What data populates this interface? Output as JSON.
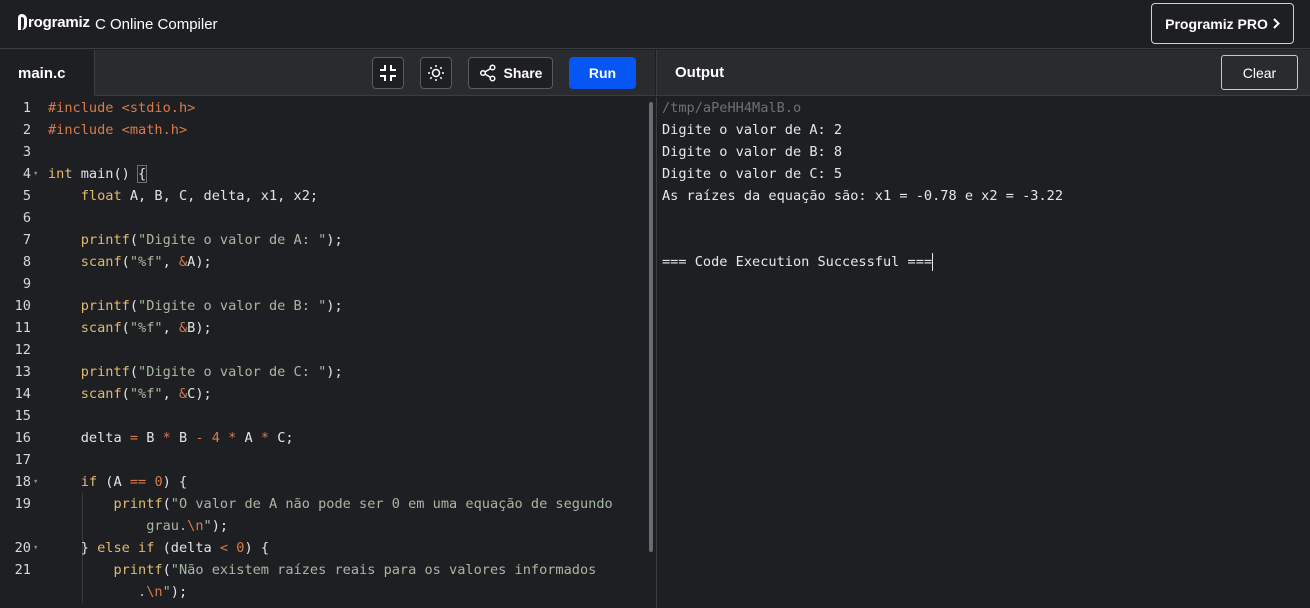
{
  "header": {
    "logo_text": "rogramiz",
    "title": "C Online Compiler",
    "pro_button": "Programiz PRO"
  },
  "editor": {
    "file_tab": "main.c",
    "share_label": "Share",
    "run_label": "Run",
    "lines": [
      {
        "n": "1",
        "fold": false,
        "segs": [
          [
            "inc",
            "#include "
          ],
          [
            "op",
            "<stdio.h>"
          ]
        ]
      },
      {
        "n": "2",
        "fold": false,
        "segs": [
          [
            "inc",
            "#include "
          ],
          [
            "op",
            "<math.h>"
          ]
        ]
      },
      {
        "n": "3",
        "fold": false,
        "segs": []
      },
      {
        "n": "4",
        "fold": true,
        "segs": [
          [
            "kw",
            "int"
          ],
          [
            "",
            " main() "
          ],
          [
            "brace",
            "{"
          ]
        ]
      },
      {
        "n": "5",
        "fold": false,
        "segs": [
          [
            "",
            "    "
          ],
          [
            "kw",
            "float"
          ],
          [
            "",
            " A, B, C, delta, x1, x2;"
          ]
        ]
      },
      {
        "n": "6",
        "fold": false,
        "segs": []
      },
      {
        "n": "7",
        "fold": false,
        "segs": [
          [
            "",
            "    "
          ],
          [
            "fn",
            "printf"
          ],
          [
            "",
            "("
          ],
          [
            "str",
            "\"Digite o valor de A: \""
          ],
          [
            "",
            ");"
          ]
        ]
      },
      {
        "n": "8",
        "fold": false,
        "segs": [
          [
            "",
            "    "
          ],
          [
            "fn",
            "scanf"
          ],
          [
            "",
            "("
          ],
          [
            "str",
            "\"%f\""
          ],
          [
            "",
            ", "
          ],
          [
            "op",
            "&"
          ],
          [
            "",
            "A);"
          ]
        ]
      },
      {
        "n": "9",
        "fold": false,
        "segs": []
      },
      {
        "n": "10",
        "fold": false,
        "segs": [
          [
            "",
            "    "
          ],
          [
            "fn",
            "printf"
          ],
          [
            "",
            "("
          ],
          [
            "str",
            "\"Digite o valor de B: \""
          ],
          [
            "",
            ");"
          ]
        ]
      },
      {
        "n": "11",
        "fold": false,
        "segs": [
          [
            "",
            "    "
          ],
          [
            "fn",
            "scanf"
          ],
          [
            "",
            "("
          ],
          [
            "str",
            "\"%f\""
          ],
          [
            "",
            ", "
          ],
          [
            "op",
            "&"
          ],
          [
            "",
            "B);"
          ]
        ]
      },
      {
        "n": "12",
        "fold": false,
        "segs": []
      },
      {
        "n": "13",
        "fold": false,
        "segs": [
          [
            "",
            "    "
          ],
          [
            "fn",
            "printf"
          ],
          [
            "",
            "("
          ],
          [
            "str",
            "\"Digite o valor de C: \""
          ],
          [
            "",
            ");"
          ]
        ]
      },
      {
        "n": "14",
        "fold": false,
        "segs": [
          [
            "",
            "    "
          ],
          [
            "fn",
            "scanf"
          ],
          [
            "",
            "("
          ],
          [
            "str",
            "\"%f\""
          ],
          [
            "",
            ", "
          ],
          [
            "op",
            "&"
          ],
          [
            "",
            "C);"
          ]
        ]
      },
      {
        "n": "15",
        "fold": false,
        "segs": []
      },
      {
        "n": "16",
        "fold": false,
        "segs": [
          [
            "",
            "    delta "
          ],
          [
            "op",
            "="
          ],
          [
            "",
            " B "
          ],
          [
            "op",
            "*"
          ],
          [
            "",
            " B "
          ],
          [
            "op",
            "-"
          ],
          [
            "",
            " "
          ],
          [
            "num",
            "4"
          ],
          [
            "",
            " "
          ],
          [
            "op",
            "*"
          ],
          [
            "",
            " A "
          ],
          [
            "op",
            "*"
          ],
          [
            "",
            " C;"
          ]
        ]
      },
      {
        "n": "17",
        "fold": false,
        "segs": []
      },
      {
        "n": "18",
        "fold": true,
        "segs": [
          [
            "",
            "    "
          ],
          [
            "kw",
            "if"
          ],
          [
            "",
            " (A "
          ],
          [
            "op",
            "=="
          ],
          [
            "",
            " "
          ],
          [
            "num",
            "0"
          ],
          [
            "",
            ") {"
          ]
        ]
      },
      {
        "n": "19",
        "fold": false,
        "segs": [
          [
            "",
            "        "
          ],
          [
            "fn",
            "printf"
          ],
          [
            "",
            "("
          ],
          [
            "str",
            "\"O valor de A não pode ser 0 em uma equação de segundo"
          ]
        ]
      },
      {
        "n": "",
        "fold": false,
        "segs": [
          [
            "",
            "            "
          ],
          [
            "str",
            "grau."
          ],
          [
            "op",
            "\\n"
          ],
          [
            "str",
            "\""
          ],
          [
            "",
            ");"
          ]
        ]
      },
      {
        "n": "20",
        "fold": true,
        "segs": [
          [
            "",
            "    } "
          ],
          [
            "kw",
            "else if"
          ],
          [
            "",
            " (delta "
          ],
          [
            "op",
            "<"
          ],
          [
            "",
            " "
          ],
          [
            "num",
            "0"
          ],
          [
            "",
            ") {"
          ]
        ]
      },
      {
        "n": "21",
        "fold": false,
        "segs": [
          [
            "",
            "        "
          ],
          [
            "fn",
            "printf"
          ],
          [
            "",
            "("
          ],
          [
            "str",
            "\"Não existem raízes reais para os valores informados"
          ]
        ]
      },
      {
        "n": "",
        "fold": false,
        "segs": [
          [
            "",
            "           "
          ],
          [
            "str",
            "."
          ],
          [
            "op",
            "\\n"
          ],
          [
            "str",
            "\""
          ],
          [
            "",
            ");"
          ]
        ]
      }
    ]
  },
  "output": {
    "title": "Output",
    "clear_label": "Clear",
    "path": "/tmp/aPeHH4MalB.o",
    "lines": [
      "Digite o valor de A: 2",
      "Digite o valor de B: 8",
      "Digite o valor de C: 5",
      "As raízes da equação são: x1 = -0.78 e x2 = -3.22",
      "",
      "",
      "=== Code Execution Successful ==="
    ]
  },
  "colors": {
    "run_button": "#0556f3",
    "background": "#1e1f22",
    "keyword": "#e2b873",
    "string": "#a7b8a0",
    "number": "#d97a4a"
  }
}
